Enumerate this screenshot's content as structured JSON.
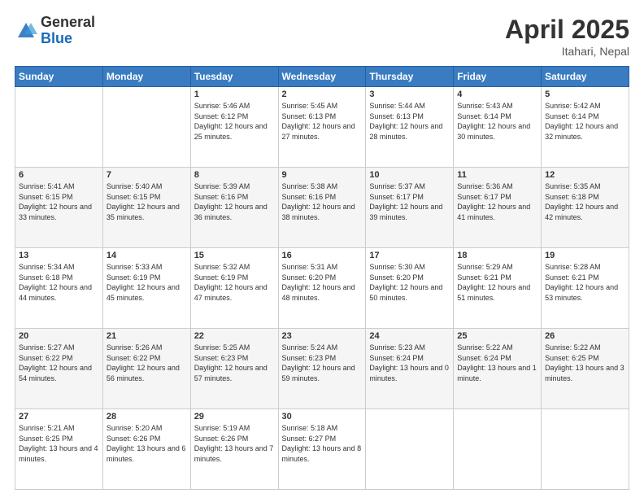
{
  "header": {
    "logo_general": "General",
    "logo_blue": "Blue",
    "month_title": "April 2025",
    "subtitle": "Itahari, Nepal"
  },
  "weekdays": [
    "Sunday",
    "Monday",
    "Tuesday",
    "Wednesday",
    "Thursday",
    "Friday",
    "Saturday"
  ],
  "weeks": [
    [
      {
        "day": "",
        "info": ""
      },
      {
        "day": "",
        "info": ""
      },
      {
        "day": "1",
        "info": "Sunrise: 5:46 AM\nSunset: 6:12 PM\nDaylight: 12 hours and 25 minutes."
      },
      {
        "day": "2",
        "info": "Sunrise: 5:45 AM\nSunset: 6:13 PM\nDaylight: 12 hours and 27 minutes."
      },
      {
        "day": "3",
        "info": "Sunrise: 5:44 AM\nSunset: 6:13 PM\nDaylight: 12 hours and 28 minutes."
      },
      {
        "day": "4",
        "info": "Sunrise: 5:43 AM\nSunset: 6:14 PM\nDaylight: 12 hours and 30 minutes."
      },
      {
        "day": "5",
        "info": "Sunrise: 5:42 AM\nSunset: 6:14 PM\nDaylight: 12 hours and 32 minutes."
      }
    ],
    [
      {
        "day": "6",
        "info": "Sunrise: 5:41 AM\nSunset: 6:15 PM\nDaylight: 12 hours and 33 minutes."
      },
      {
        "day": "7",
        "info": "Sunrise: 5:40 AM\nSunset: 6:15 PM\nDaylight: 12 hours and 35 minutes."
      },
      {
        "day": "8",
        "info": "Sunrise: 5:39 AM\nSunset: 6:16 PM\nDaylight: 12 hours and 36 minutes."
      },
      {
        "day": "9",
        "info": "Sunrise: 5:38 AM\nSunset: 6:16 PM\nDaylight: 12 hours and 38 minutes."
      },
      {
        "day": "10",
        "info": "Sunrise: 5:37 AM\nSunset: 6:17 PM\nDaylight: 12 hours and 39 minutes."
      },
      {
        "day": "11",
        "info": "Sunrise: 5:36 AM\nSunset: 6:17 PM\nDaylight: 12 hours and 41 minutes."
      },
      {
        "day": "12",
        "info": "Sunrise: 5:35 AM\nSunset: 6:18 PM\nDaylight: 12 hours and 42 minutes."
      }
    ],
    [
      {
        "day": "13",
        "info": "Sunrise: 5:34 AM\nSunset: 6:18 PM\nDaylight: 12 hours and 44 minutes."
      },
      {
        "day": "14",
        "info": "Sunrise: 5:33 AM\nSunset: 6:19 PM\nDaylight: 12 hours and 45 minutes."
      },
      {
        "day": "15",
        "info": "Sunrise: 5:32 AM\nSunset: 6:19 PM\nDaylight: 12 hours and 47 minutes."
      },
      {
        "day": "16",
        "info": "Sunrise: 5:31 AM\nSunset: 6:20 PM\nDaylight: 12 hours and 48 minutes."
      },
      {
        "day": "17",
        "info": "Sunrise: 5:30 AM\nSunset: 6:20 PM\nDaylight: 12 hours and 50 minutes."
      },
      {
        "day": "18",
        "info": "Sunrise: 5:29 AM\nSunset: 6:21 PM\nDaylight: 12 hours and 51 minutes."
      },
      {
        "day": "19",
        "info": "Sunrise: 5:28 AM\nSunset: 6:21 PM\nDaylight: 12 hours and 53 minutes."
      }
    ],
    [
      {
        "day": "20",
        "info": "Sunrise: 5:27 AM\nSunset: 6:22 PM\nDaylight: 12 hours and 54 minutes."
      },
      {
        "day": "21",
        "info": "Sunrise: 5:26 AM\nSunset: 6:22 PM\nDaylight: 12 hours and 56 minutes."
      },
      {
        "day": "22",
        "info": "Sunrise: 5:25 AM\nSunset: 6:23 PM\nDaylight: 12 hours and 57 minutes."
      },
      {
        "day": "23",
        "info": "Sunrise: 5:24 AM\nSunset: 6:23 PM\nDaylight: 12 hours and 59 minutes."
      },
      {
        "day": "24",
        "info": "Sunrise: 5:23 AM\nSunset: 6:24 PM\nDaylight: 13 hours and 0 minutes."
      },
      {
        "day": "25",
        "info": "Sunrise: 5:22 AM\nSunset: 6:24 PM\nDaylight: 13 hours and 1 minute."
      },
      {
        "day": "26",
        "info": "Sunrise: 5:22 AM\nSunset: 6:25 PM\nDaylight: 13 hours and 3 minutes."
      }
    ],
    [
      {
        "day": "27",
        "info": "Sunrise: 5:21 AM\nSunset: 6:25 PM\nDaylight: 13 hours and 4 minutes."
      },
      {
        "day": "28",
        "info": "Sunrise: 5:20 AM\nSunset: 6:26 PM\nDaylight: 13 hours and 6 minutes."
      },
      {
        "day": "29",
        "info": "Sunrise: 5:19 AM\nSunset: 6:26 PM\nDaylight: 13 hours and 7 minutes."
      },
      {
        "day": "30",
        "info": "Sunrise: 5:18 AM\nSunset: 6:27 PM\nDaylight: 13 hours and 8 minutes."
      },
      {
        "day": "",
        "info": ""
      },
      {
        "day": "",
        "info": ""
      },
      {
        "day": "",
        "info": ""
      }
    ]
  ]
}
